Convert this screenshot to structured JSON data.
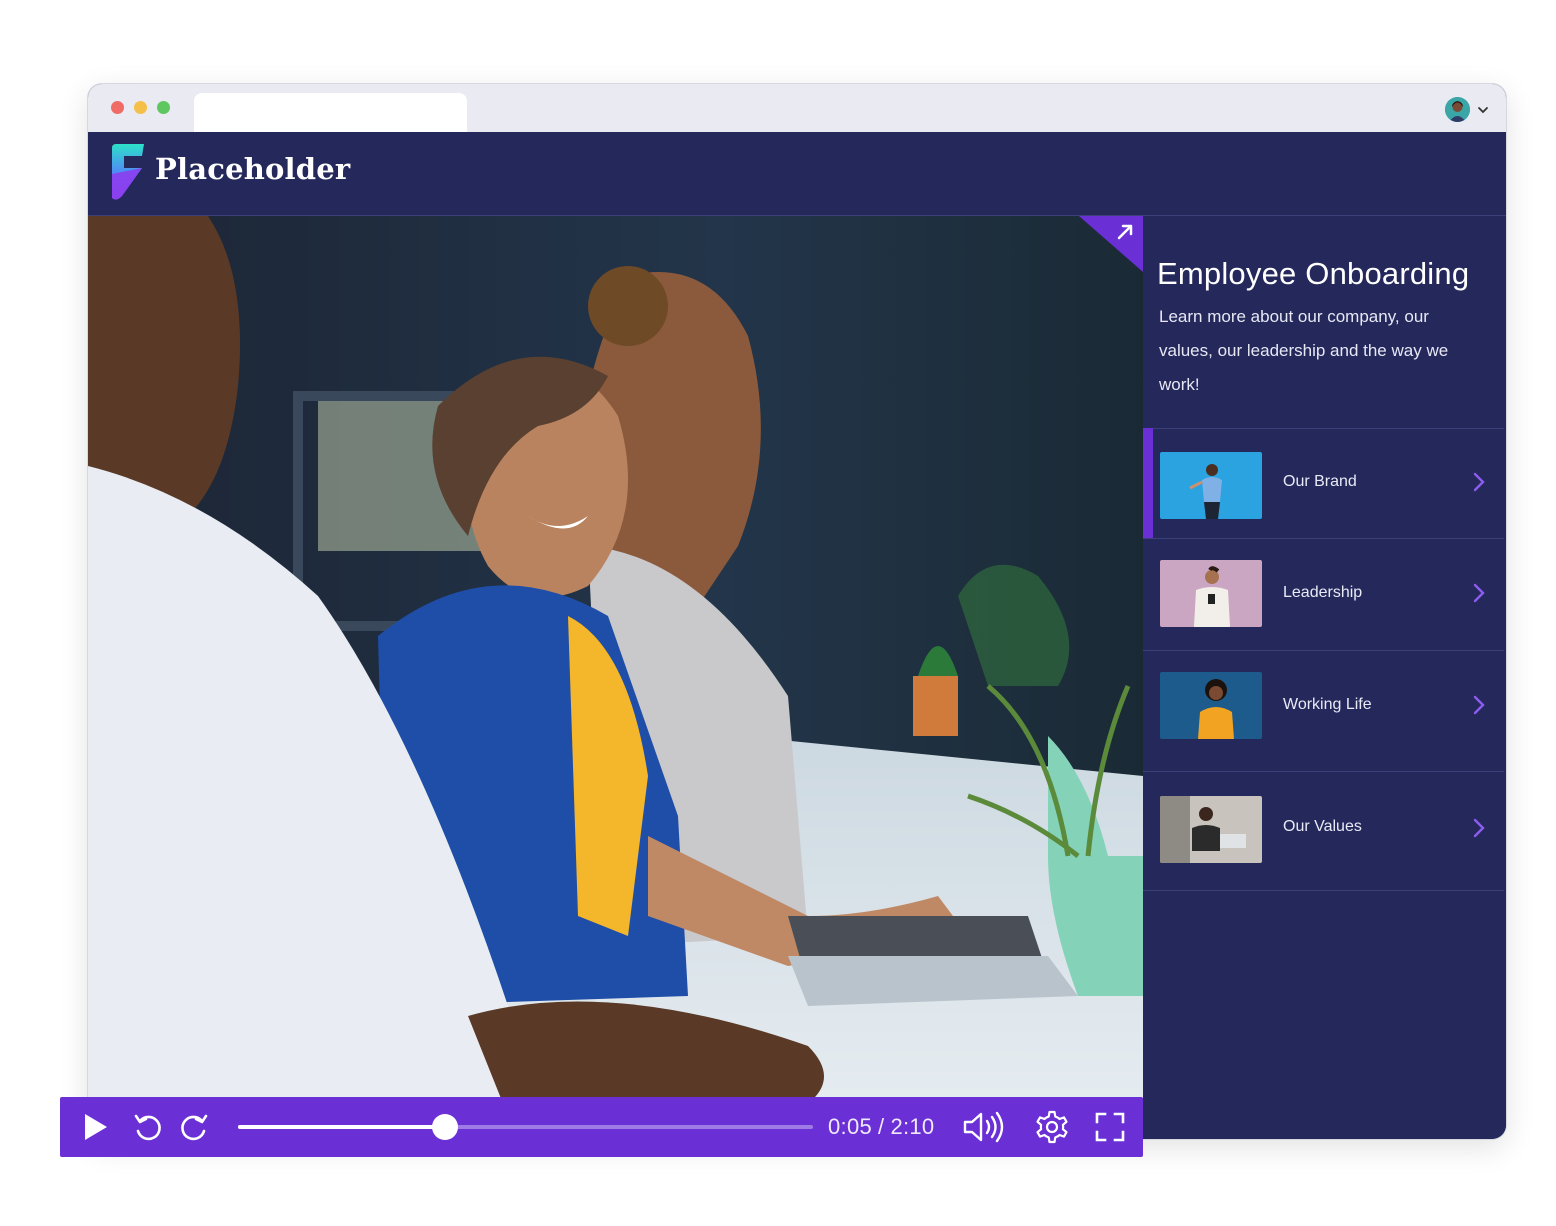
{
  "app": {
    "brand_name": "Placeholder",
    "accent_color": "#6b2fd6",
    "header_color": "#24285b"
  },
  "sidebar": {
    "title": "Employee Onboarding",
    "description": "Learn more about our company, our values, our leadership and the way we work!",
    "items": [
      {
        "label": "Our Brand",
        "active": true,
        "icon": "chevron-right-icon"
      },
      {
        "label": "Leadership",
        "active": false,
        "icon": "chevron-right-icon"
      },
      {
        "label": "Working Life",
        "active": false,
        "icon": "chevron-right-icon"
      },
      {
        "label": "Our Values",
        "active": false,
        "icon": "chevron-right-icon"
      }
    ]
  },
  "player": {
    "current_time": "0:05",
    "duration": "2:10",
    "separator": "/",
    "progress_fraction": 0.36,
    "icons": [
      "play-icon",
      "rewind-icon",
      "forward-icon",
      "volume-icon",
      "settings-icon",
      "fullscreen-icon"
    ]
  }
}
